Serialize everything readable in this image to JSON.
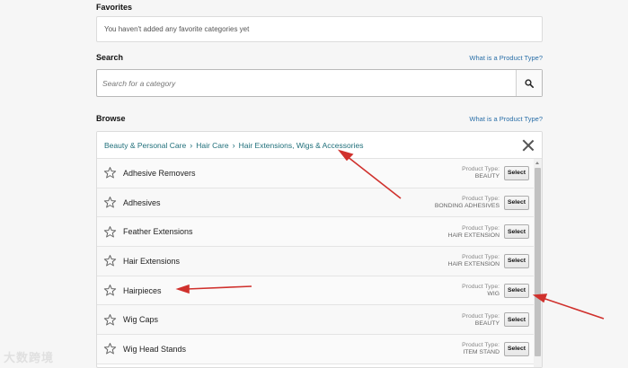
{
  "favorites": {
    "title": "Favorites",
    "empty_text": "You haven't added any favorite categories yet"
  },
  "search": {
    "title": "Search",
    "help_link": "What is a Product Type?",
    "placeholder": "Search for a category",
    "button_icon": "search-icon"
  },
  "browse": {
    "title": "Browse",
    "help_link": "What is a Product Type?",
    "breadcrumb": [
      "Beauty & Personal Care",
      "Hair Care",
      "Hair Extensions, Wigs & Accessories"
    ],
    "close_icon": "close-icon",
    "product_type_label": "Product Type:",
    "select_label": "Select",
    "rows": [
      {
        "name": "Adhesive Removers",
        "product_type": "BEAUTY"
      },
      {
        "name": "Adhesives",
        "product_type": "BONDING ADHESIVES"
      },
      {
        "name": "Feather Extensions",
        "product_type": "HAIR EXTENSION"
      },
      {
        "name": "Hair Extensions",
        "product_type": "HAIR EXTENSION"
      },
      {
        "name": "Hairpieces",
        "product_type": "WIG"
      },
      {
        "name": "Wig Caps",
        "product_type": "BEAUTY"
      },
      {
        "name": "Wig Head Stands",
        "product_type": "ITEM STAND"
      }
    ]
  },
  "watermark": "大数跨境",
  "colors": {
    "link": "#2a6fa8",
    "breadcrumb": "#1f6f7a",
    "annotation_arrow": "#d0312d"
  }
}
